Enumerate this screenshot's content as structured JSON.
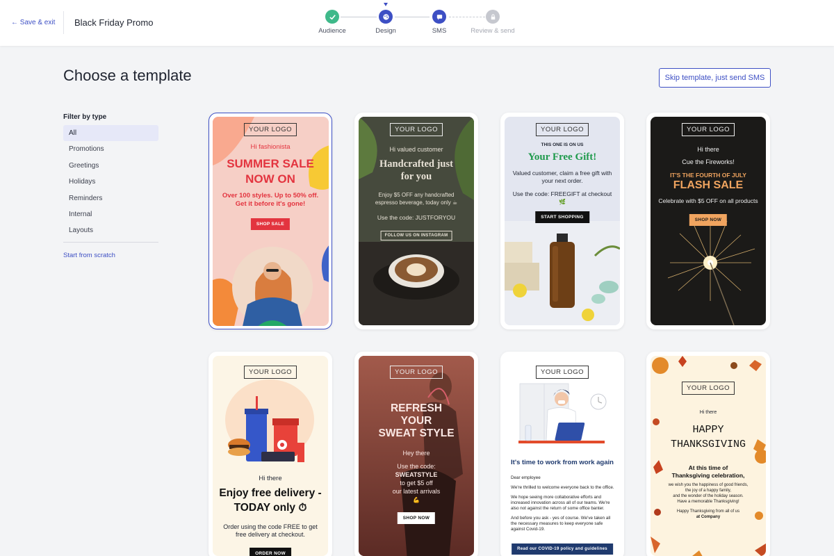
{
  "header": {
    "save_exit": "← Save & exit",
    "campaign_title": "Black Friday Promo",
    "steps": [
      {
        "label": "Audience",
        "state": "done"
      },
      {
        "label": "Design",
        "state": "active"
      },
      {
        "label": "SMS",
        "state": "upcoming"
      },
      {
        "label": "Review & send",
        "state": "locked"
      }
    ]
  },
  "page": {
    "title": "Choose a template",
    "skip_button": "Skip template, just send SMS"
  },
  "filter": {
    "heading": "Filter by type",
    "items": [
      "All",
      "Promotions",
      "Greetings",
      "Holidays",
      "Reminders",
      "Internal",
      "Layouts"
    ],
    "selected": "All",
    "start_from_scratch": "Start from scratch"
  },
  "colors": {
    "accent": "#3d4fc4",
    "done_green": "#3fb98a",
    "summer_red": "#e3343f",
    "gift_green": "#1f9a4c",
    "flash_orange": "#f0a45f"
  },
  "templates": [
    {
      "logo": "YOUR LOGO",
      "greeting": "Hi fashionista",
      "headline_1": "SUMMER SALE",
      "headline_2": "NOW ON",
      "body_1": "Over 100 styles. Up to 50% off.",
      "body_2": "Get it before it's gone!",
      "cta": "SHOP SALE"
    },
    {
      "logo": "YOUR LOGO",
      "greeting": "Hi valued customer",
      "headline_1": "Handcrafted just",
      "headline_2": "for you",
      "body_1": "Enjoy $5 OFF any handcrafted",
      "body_2": "espresso beverage, today only ☕",
      "code_line": "Use the code: JUSTFORYOU",
      "cta": "FOLLOW US ON INSTAGRAM"
    },
    {
      "logo": "YOUR LOGO",
      "kicker": "THIS ONE IS ON US",
      "headline": "Your Free Gift!",
      "body_1": "Valued customer, claim a free gift with",
      "body_2": "your next order.",
      "code_line": "Use the code: FREEGIFT at checkout",
      "cta": "START SHOPPING"
    },
    {
      "logo": "YOUR LOGO",
      "greeting": "Hi there",
      "subline": "Cue the Fireworks!",
      "kicker": "IT'S THE FOURTH OF JULY",
      "headline": "FLASH SALE",
      "body": "Celebrate with $5 OFF on all products",
      "cta": "SHOP NOW"
    },
    {
      "logo": "YOUR LOGO",
      "greeting": "Hi there",
      "headline_1": "Enjoy free delivery -",
      "headline_2": "TODAY only ⏱",
      "body_1": "Order using the code FREE to get",
      "body_2": "free delivery at checkout.",
      "cta": "ORDER NOW"
    },
    {
      "logo": "YOUR LOGO",
      "headline_1": "REFRESH",
      "headline_2": "YOUR",
      "headline_3": "SWEAT STYLE",
      "greeting": "Hey there",
      "body_1": "Use the code:",
      "body_2": "SWEATSTYLE",
      "body_3": "to get $5 off",
      "body_4": "our latest arrivals",
      "cta": "SHOP NOW"
    },
    {
      "logo": "YOUR LOGO",
      "headline": "It's time to work from work again",
      "salutation": "Dear employee",
      "para_1": "We're thrilled to welcome everyone back to the office.",
      "para_2": "We hope seeing more collaborative efforts and increased innovation across all of our teams. We're also not against the return of some office banter.",
      "para_3": "And before you ask - yes of course. We've taken all the necessary measures to keep everyone safe against Covid-19.",
      "cta": "Read our COVID-19 policy and guidelines"
    },
    {
      "logo": "YOUR LOGO",
      "greeting": "Hi there",
      "headline_1": "HAPPY",
      "headline_2": "THANKSGIVING",
      "subhead_1": "At this time of",
      "subhead_2": "Thanksgiving celebration,",
      "body_1": "we wish you the happiness of good friends,",
      "body_2": "the joy of a happy family,",
      "body_3": "and the wonder of the holiday season.",
      "body_4": "Have a memorable Thanksgiving!",
      "sign_1": "Happy Thanksgiving from all of us",
      "sign_2": "at Company"
    }
  ]
}
